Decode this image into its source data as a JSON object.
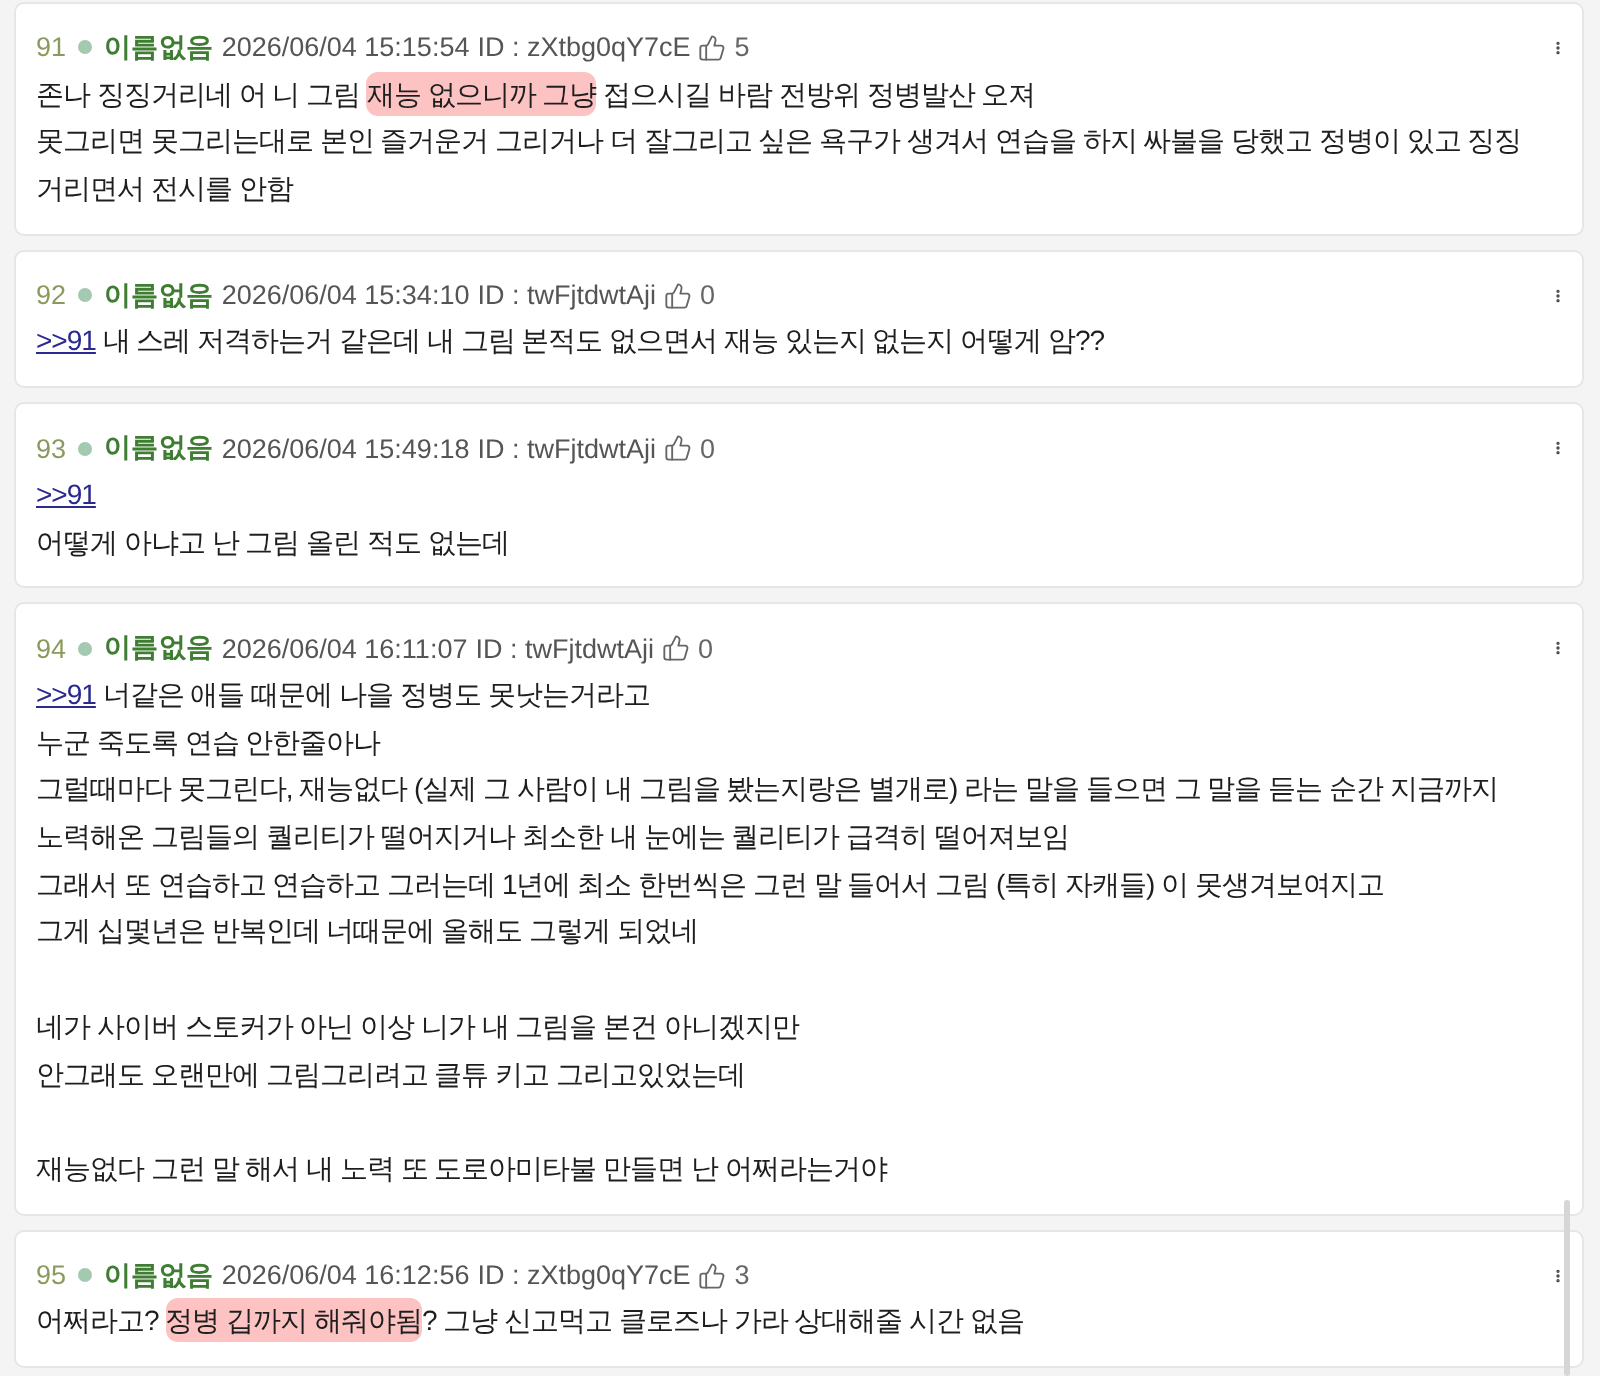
{
  "posts": [
    {
      "number": "91",
      "name": "이름없음",
      "date": "2026/06/04 15:15:54",
      "id": "ID : zXtbg0qY7cE",
      "likes": "5",
      "paragraphs": [
        [
          [
            {
              "kind": "text",
              "text": "존나 징징거리네 어 니 그림 ",
              "highlighted": false
            },
            {
              "kind": "text",
              "text": "재능 없으니까 그냥",
              "highlighted": true
            },
            {
              "kind": "text",
              "text": " 접으시길 바람 전방위 정병발산 오져",
              "highlighted": false
            }
          ],
          [
            {
              "kind": "text",
              "text": "못그리면 못그리는대로 본인 즐거운거 그리거나 더 잘그리고 싶은 욕구가 생겨서 연습을 하지 싸불을 당했고 정병이 있고 징징",
              "highlighted": false
            }
          ],
          [
            {
              "kind": "text",
              "text": "거리면서 전시를 안함",
              "highlighted": false
            }
          ]
        ]
      ]
    },
    {
      "number": "92",
      "name": "이름없음",
      "date": "2026/06/04 15:34:10",
      "id": "ID : twFjtdwtAji",
      "likes": "0",
      "paragraphs": [
        [
          [
            {
              "kind": "link",
              "text": ">>91",
              "highlighted": false
            },
            {
              "kind": "text",
              "text": " 내 스레 저격하는거 같은데 내 그림 본적도 없으면서 재능 있는지 없는지 어떻게 암??",
              "highlighted": false
            }
          ]
        ]
      ]
    },
    {
      "number": "93",
      "name": "이름없음",
      "date": "2026/06/04 15:49:18",
      "id": "ID : twFjtdwtAji",
      "likes": "0",
      "paragraphs": [
        [
          [
            {
              "kind": "link",
              "text": ">>91",
              "highlighted": false
            }
          ],
          [
            {
              "kind": "text",
              "text": "어떻게 아냐고 난 그림 올린 적도 없는데",
              "highlighted": false
            }
          ]
        ]
      ]
    },
    {
      "number": "94",
      "name": "이름없음",
      "date": "2026/06/04 16:11:07",
      "id": "ID : twFjtdwtAji",
      "likes": "0",
      "paragraphs": [
        [
          [
            {
              "kind": "link",
              "text": ">>91",
              "highlighted": false
            },
            {
              "kind": "text",
              "text": " 너같은 애들 때문에 나을 정병도 못낫는거라고",
              "highlighted": false
            }
          ],
          [
            {
              "kind": "text",
              "text": "누군 죽도록 연습 안한줄아나",
              "highlighted": false
            }
          ],
          [
            {
              "kind": "text",
              "text": "그럴때마다 못그린다, 재능없다 (실제 그 사람이 내 그림을 봤는지랑은 별개로) 라는 말을 들으면 그 말을 듣는 순간 지금까지",
              "highlighted": false
            }
          ],
          [
            {
              "kind": "text",
              "text": "노력해온 그림들의 퀄리티가 떨어지거나 최소한 내 눈에는 퀄리티가 급격히 떨어져보임",
              "highlighted": false
            }
          ],
          [
            {
              "kind": "text",
              "text": "그래서 또 연습하고 연습하고 그러는데 1년에 최소 한번씩은 그런 말 들어서 그림 (특히 자캐들) 이 못생겨보여지고",
              "highlighted": false
            }
          ],
          [
            {
              "kind": "text",
              "text": "그게 십몇년은 반복인데 너때문에 올해도 그렇게 되었네",
              "highlighted": false
            }
          ]
        ],
        [
          [
            {
              "kind": "text",
              "text": "네가 사이버 스토커가 아닌 이상 니가 내 그림을 본건 아니겠지만",
              "highlighted": false
            }
          ],
          [
            {
              "kind": "text",
              "text": "안그래도 오랜만에 그림그리려고 클튜 키고 그리고있었는데",
              "highlighted": false
            }
          ]
        ],
        [
          [
            {
              "kind": "text",
              "text": "재능없다 그런 말 해서 내 노력 또 도로아미타불 만들면 난 어쩌라는거야",
              "highlighted": false
            }
          ]
        ]
      ]
    },
    {
      "number": "95",
      "name": "이름없음",
      "date": "2026/06/04 16:12:56",
      "id": "ID : zXtbg0qY7cE",
      "likes": "3",
      "paragraphs": [
        [
          [
            {
              "kind": "text",
              "text": "어쩌라고? ",
              "highlighted": false
            },
            {
              "kind": "text",
              "text": "정병 깁까지 해줘야됨",
              "highlighted": true
            },
            {
              "kind": "text",
              "text": "? 그냥 신고먹고 클로즈나 가라 상대해줄 시간 없음",
              "highlighted": false
            }
          ]
        ]
      ]
    }
  ]
}
